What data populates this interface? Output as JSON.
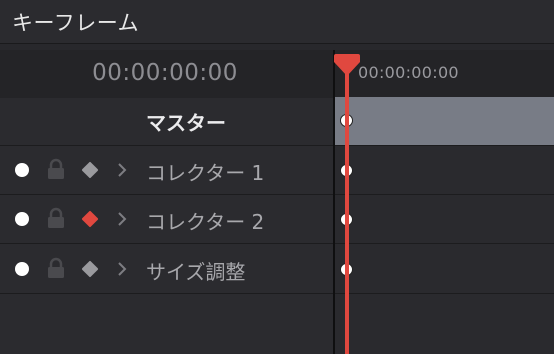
{
  "panel": {
    "title": "キーフレーム"
  },
  "timecode": {
    "current": "00:00:00:00",
    "ruler_start": "00:00:00:00"
  },
  "master_row": {
    "label": "マスター",
    "track_color": "#787c86"
  },
  "tracks": [
    {
      "label": "コレクター 1",
      "diamond_color": "#9a9a9e",
      "diamond_active": false
    },
    {
      "label": "コレクター 2",
      "diamond_color": "#e0483f",
      "diamond_active": true
    },
    {
      "label": "サイズ調整",
      "diamond_color": "#9a9a9e",
      "diamond_active": false
    }
  ],
  "icons": {
    "visibility": "white-dot-icon",
    "lock": "lock-icon",
    "keyframe": "diamond-icon",
    "expand": "chevron-right-icon"
  },
  "colors": {
    "accent": "#e0483f",
    "background": "#28282c",
    "master_track": "#787c86"
  }
}
